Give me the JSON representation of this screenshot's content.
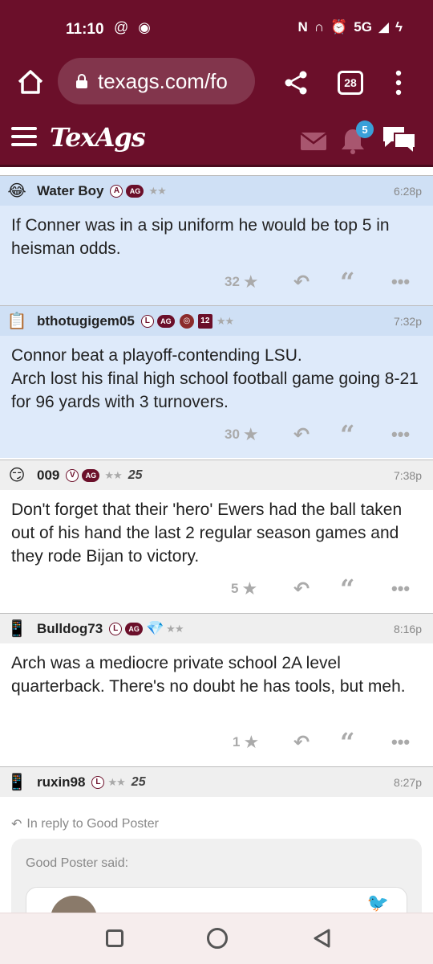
{
  "status_bar": {
    "time": "11:10",
    "network": "5G"
  },
  "browser": {
    "url_visible": "texags.com/fo",
    "tab_count": "28"
  },
  "site": {
    "logo": "TexAgs",
    "notification_count": "5"
  },
  "posts": [
    {
      "username": "Water Boy",
      "badges": [
        "A",
        "AG"
      ],
      "stars": "★★",
      "time": "6:28p",
      "body": "If Conner was in a sip uniform he would be top 5 in heisman odds.",
      "likes": "32"
    },
    {
      "username": "bthotugigem05",
      "badges": [
        "L",
        "AG"
      ],
      "stars": "★★",
      "time": "7:32p",
      "body_lines": [
        "Connor beat a playoff-contending LSU.",
        "Arch lost his final high school football game going 8-21 for 96 yards with 3 turnovers."
      ],
      "likes": "30"
    },
    {
      "username": "009",
      "badges": [
        "V",
        "AG"
      ],
      "stars": "★★",
      "extra": "25",
      "time": "7:38p",
      "body": "Don't forget that their 'hero' Ewers had the ball taken out of his hand the last 2 regular season games and they rode Bijan to victory.",
      "likes": "5"
    },
    {
      "username": "Bulldog73",
      "badges": [
        "L",
        "AG"
      ],
      "stars": "★★",
      "time": "8:16p",
      "body": "Arch was a mediocre private school 2A level quarterback. There's no doubt he has tools, but meh.",
      "likes": "1"
    },
    {
      "username": "ruxin98",
      "badges": [
        "L"
      ],
      "stars": "★★",
      "extra": "25",
      "time": "8:27p",
      "reply_to": "In reply to Good Poster",
      "quote_label": "Good Poster said:"
    }
  ],
  "badges_12": "12",
  "colors": {
    "maroon": "#6b0f2a",
    "highlight_blue": "#deeafa"
  }
}
